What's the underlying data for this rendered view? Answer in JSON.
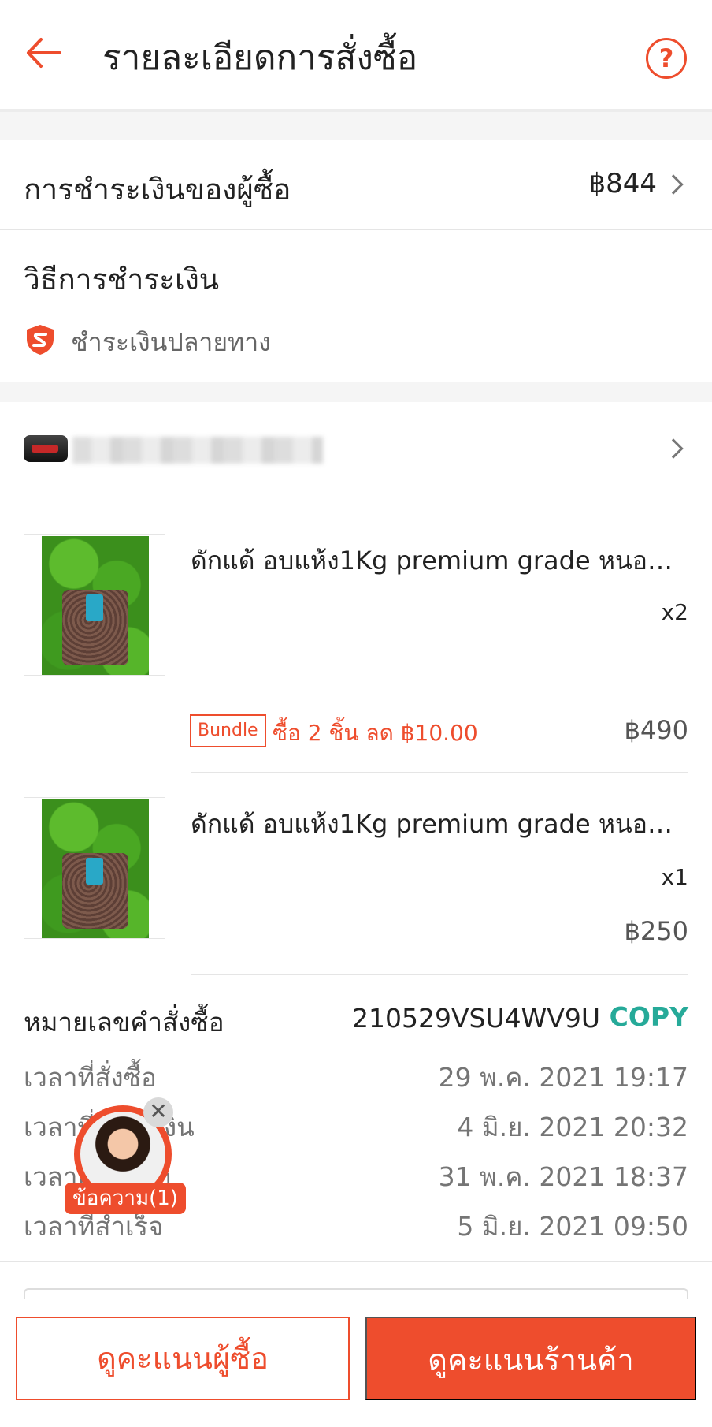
{
  "header": {
    "title": "รายละเอียดการสั่งซื้อ",
    "help_icon": "?"
  },
  "payment": {
    "buyer_payment_label": "การชำระเงินของผู้ซื้อ",
    "buyer_payment_amount": "฿844",
    "method_label": "วิธีการชำระเงิน",
    "method_value": "ชำระเงินปลายทาง"
  },
  "products": [
    {
      "name": "ดักแด้ อบแห้ง1Kg premium grade หนอน...",
      "qty": "x2",
      "bundle_tag": "Bundle",
      "bundle_text": "ซื้อ 2 ชิ้น ลด ฿10.00",
      "price": "฿490"
    },
    {
      "name": "ดักแด้ อบแห้ง1Kg premium grade หนอน...",
      "qty": "x1",
      "price": "฿250"
    }
  ],
  "order": {
    "id_label": "หมายเลขคำสั่งซื้อ",
    "id_value": "210529VSU4WV9U",
    "copy_label": "COPY",
    "times": [
      {
        "label": "เวลาที่สั่งซื้อ",
        "value": "29 พ.ค. 2021 19:17"
      },
      {
        "label": "เวลาที่ชำระเงิน",
        "value": "4 มิ.ย. 2021 20:32"
      },
      {
        "label": "เวลาส่งสินค้า",
        "value": "31 พ.ค. 2021 18:37"
      },
      {
        "label": "เวลาที่สำเร็จ",
        "value": "5 มิ.ย. 2021 09:50"
      }
    ]
  },
  "chat": {
    "badge": "ข้อความ(1)",
    "close_icon": "✕"
  },
  "footer": {
    "buyer_rating_label": "ดูคะแนนผู้ซื้อ",
    "shop_rating_label": "ดูคะแนนร้านค้า"
  },
  "colors": {
    "accent": "#ee4d2d",
    "copy": "#26aa99"
  }
}
